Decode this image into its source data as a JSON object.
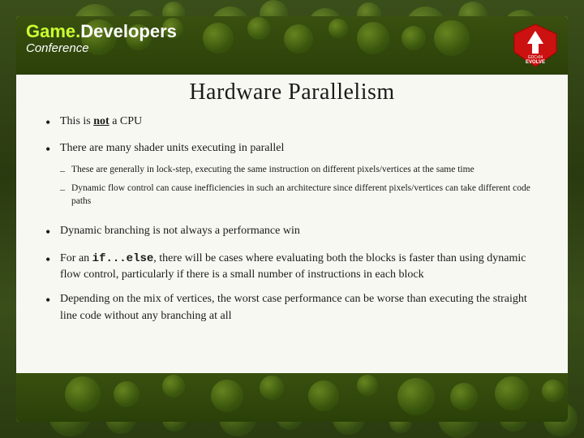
{
  "slide": {
    "title": "Hardware Parallelism"
  },
  "logo": {
    "game": "Game.",
    "developers": "Developers",
    "conference": "Conference"
  },
  "evolve": {
    "text": "EVOLVE",
    "subtext": "GDC•04"
  },
  "bullets": [
    {
      "id": "b1",
      "bullet": "•",
      "text_before": "This is ",
      "text_bold": "not",
      "text_after": " a CPU"
    },
    {
      "id": "b2",
      "bullet": "•",
      "text": "There are many shader units executing in parallel",
      "subbullets": [
        {
          "id": "sb1",
          "text": "These are generally in lock-step, executing the same instruction on different pixels/vertices at the same time"
        },
        {
          "id": "sb2",
          "text": "Dynamic flow control can cause inefficiencies in such an architecture since different pixels/vertices can take different code paths"
        }
      ]
    },
    {
      "id": "b3",
      "bullet": "•",
      "text": "Dynamic branching is not always a performance win"
    },
    {
      "id": "b4",
      "bullet": "•",
      "text_before": "For an ",
      "text_code": "if...else",
      "text_after": ", there will be cases where evaluating both the blocks is faster than using dynamic flow control, particularly if there is a small number of instructions in each block"
    },
    {
      "id": "b5",
      "bullet": "•",
      "text": "Depending on the mix of vertices, the worst case performance can be worse than executing the straight line code without any branching at all"
    }
  ]
}
